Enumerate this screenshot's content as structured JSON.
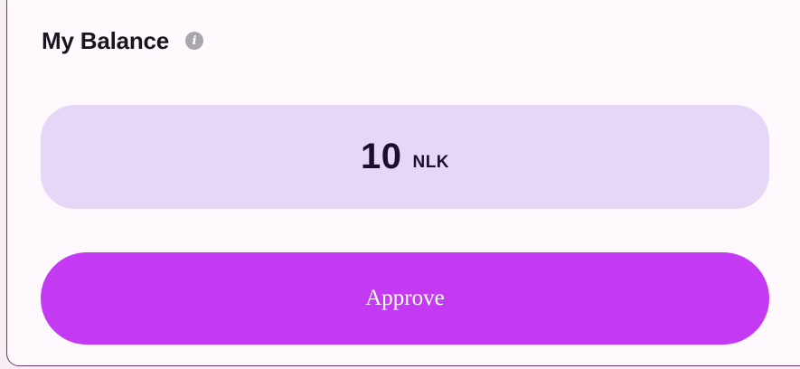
{
  "balance_card": {
    "title": "My Balance",
    "info_icon": "info-icon",
    "amount": "10",
    "unit": "NLK"
  },
  "actions": {
    "approve_label": "Approve"
  },
  "colors": {
    "balance_bg": "#e5d7f5",
    "button_bg": "#c43af2",
    "card_bg": "#fff8fc"
  }
}
